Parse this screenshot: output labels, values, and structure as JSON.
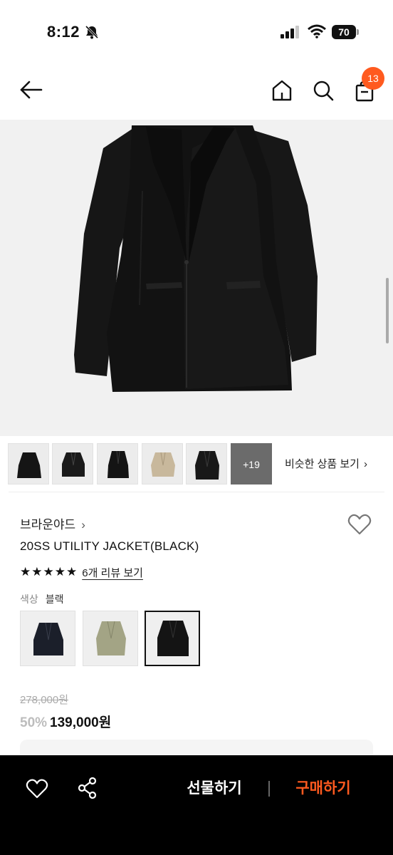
{
  "status_bar": {
    "time": "8:12",
    "battery": "70"
  },
  "header": {
    "cart_count": "13"
  },
  "thumbnails": {
    "more_label": "+19",
    "similar_label": "비슷한 상품 보기"
  },
  "product": {
    "brand": "브라운야드",
    "title": "20SS UTILITY JACKET(BLACK)",
    "rating": 5,
    "review_label": "6개 리뷰 보기",
    "color_label": "색상",
    "color_value": "블랙",
    "original_price": "278,000원",
    "discount": "50%",
    "sale_price": "139,000원"
  },
  "bottom_bar": {
    "gift_label": "선물하기",
    "buy_label": "구매하기"
  },
  "colors": {
    "accent": "#ff5a1f",
    "jacket": "#141414",
    "beige": "#c8b89c",
    "khaki": "#a3a485"
  },
  "icons": [
    "bell-mute-icon",
    "signal-icon",
    "wifi-icon",
    "back-arrow-icon",
    "home-icon",
    "search-icon",
    "shopping-bag-icon",
    "heart-icon",
    "share-icon",
    "chevron-right-icon",
    "star-icon"
  ]
}
